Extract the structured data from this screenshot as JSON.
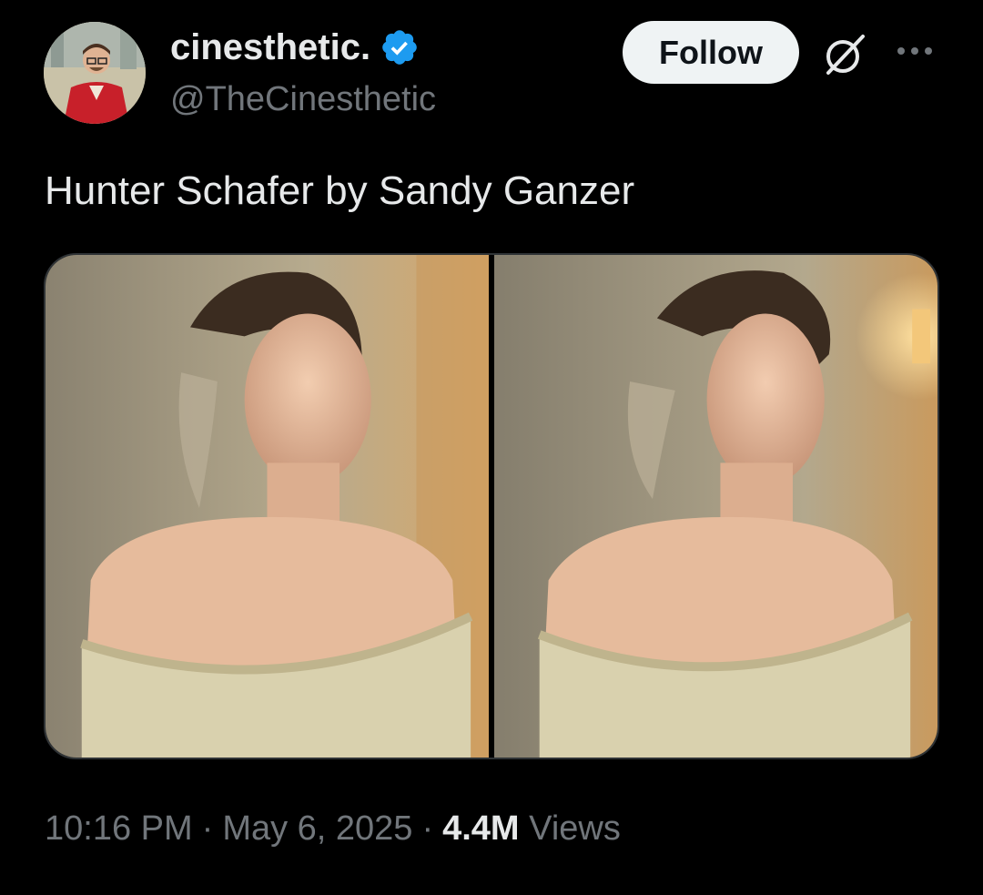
{
  "post": {
    "author": {
      "display_name": "cinesthetic.",
      "handle": "@TheCinesthetic",
      "verified": true,
      "avatar_icon": "avatar-man-red-jacket"
    },
    "follow_label": "Follow",
    "text": "Hunter Schafer by Sandy Ganzer",
    "media": [
      {
        "kind": "photo",
        "subject": "woman in off-shoulder corset, looking down"
      },
      {
        "kind": "photo",
        "subject": "woman in off-shoulder corset, profile view"
      }
    ],
    "time": "10:16 PM",
    "date": "May 6, 2025",
    "separator": "·",
    "views_count": "4.4M",
    "views_label": "Views"
  },
  "icons": {
    "verified": "verified-badge-icon",
    "grok": "grok-icon",
    "more": "more-icon"
  },
  "colors": {
    "background": "#000000",
    "primary_text": "#e7e9ea",
    "secondary_text": "#71767b",
    "verified_blue": "#1d9bf0",
    "follow_bg": "#eff3f4",
    "border": "#2f3336"
  }
}
